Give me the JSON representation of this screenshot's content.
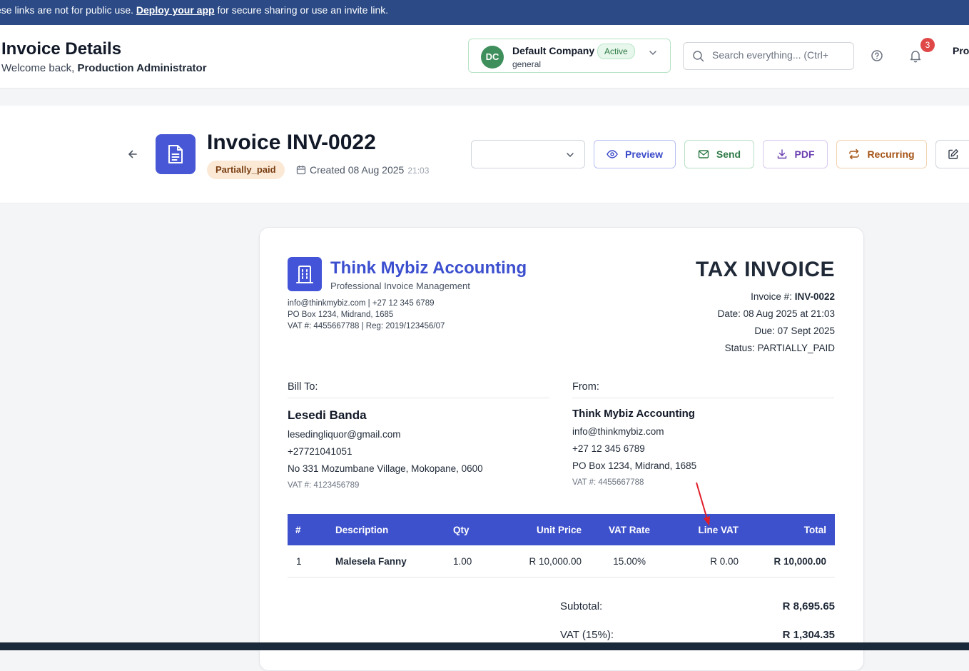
{
  "banner": {
    "prefix": "ese links are not for public use.",
    "link": "Deploy your app",
    "suffix": "for secure sharing or use an invite link."
  },
  "header": {
    "title": "Invoice Details",
    "welcome_prefix": "Welcome back,",
    "user": "Production Administrator",
    "company": {
      "initials": "DC",
      "name": "Default Company",
      "status": "Active",
      "sub": "general"
    },
    "search_placeholder": "Search everything... (Ctrl+",
    "notification_count": "3",
    "profile_label": "Pro"
  },
  "invoice_bar": {
    "title": "Invoice INV-0022",
    "status": "Partially_paid",
    "created": "Created 08 Aug 2025",
    "created_time": "21:03",
    "actions": {
      "preview": "Preview",
      "send": "Send",
      "pdf": "PDF",
      "recurring": "Recurring"
    }
  },
  "document": {
    "company_name": "Think Mybiz Accounting",
    "tagline": "Professional Invoice Management",
    "contact_line1": "info@thinkmybiz.com | +27 12 345 6789",
    "contact_line2": "PO Box 1234, Midrand, 1685",
    "contact_line3": "VAT #: 4455667788 | Reg: 2019/123456/07",
    "doc_title": "TAX INVOICE",
    "meta": {
      "invoice_label": "Invoice #:",
      "invoice_no": "INV-0022",
      "date": "Date: 08 Aug 2025 at 21:03",
      "due": "Due: 07 Sept 2025",
      "status": "Status: PARTIALLY_PAID"
    },
    "bill_to": {
      "heading": "Bill To:",
      "name": "Lesedi Banda",
      "email": "lesedingliquor@gmail.com",
      "phone": "+27721041051",
      "address": "No 331 Mozumbane Village, Mokopane, 0600",
      "vat": "VAT #: 4123456789"
    },
    "from": {
      "heading": "From:",
      "name": "Think Mybiz Accounting",
      "email": "info@thinkmybiz.com",
      "phone": "+27 12 345 6789",
      "address": "PO Box 1234, Midrand, 1685",
      "vat": "VAT #: 4455667788"
    },
    "table": {
      "headers": [
        "#",
        "Description",
        "Qty",
        "Unit Price",
        "VAT Rate",
        "Line VAT",
        "Total"
      ],
      "rows": [
        [
          "1",
          "Malesela Fanny",
          "1.00",
          "R 10,000.00",
          "15.00%",
          "R 0.00",
          "R 10,000.00"
        ]
      ]
    },
    "totals": {
      "subtotal_label": "Subtotal:",
      "subtotal": "R 8,695.65",
      "vat_label": "VAT (15%):",
      "vat": "R 1,304.35"
    }
  },
  "colors": {
    "banner": "#2b4a86",
    "accent": "#3e51cc",
    "annotation_arrow": "#e11d2a"
  }
}
